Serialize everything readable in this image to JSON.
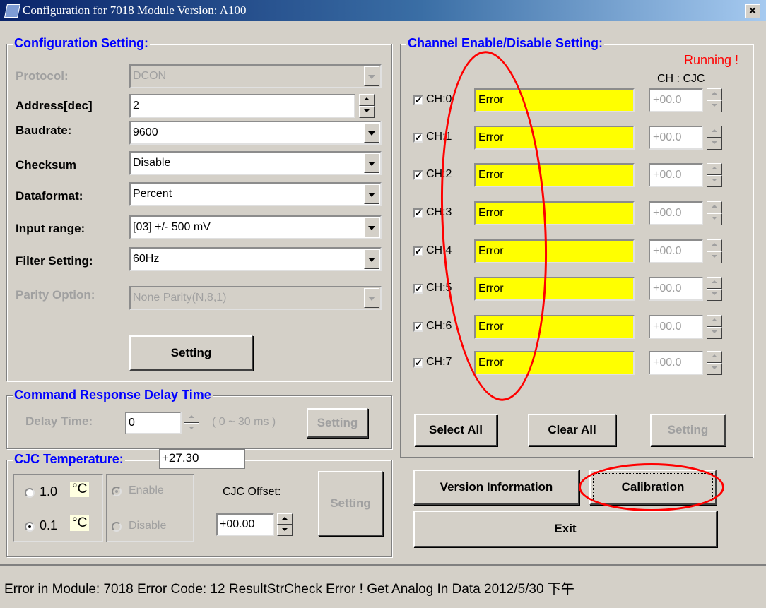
{
  "window": {
    "title": "Configuration for 7018 Module Version: A100",
    "close_glyph": "✕"
  },
  "config": {
    "legend": "Configuration Setting:",
    "protocol_label": "Protocol:",
    "protocol_value": "DCON",
    "address_label": "Address[dec]",
    "address_value": "2",
    "baud_label": "Baudrate:",
    "baud_value": "9600",
    "checksum_label": "Checksum",
    "checksum_value": "Disable",
    "dataformat_label": "Dataformat:",
    "dataformat_value": "Percent",
    "range_label": "Input range:",
    "range_value": "[03] +/- 500 mV",
    "filter_label": "Filter Setting:",
    "filter_value": "60Hz",
    "parity_label": "Parity Option:",
    "parity_value": "None Parity(N,8,1)",
    "setting_button": "Setting"
  },
  "delay": {
    "legend": "Command Response Delay Time",
    "label": "Delay Time:",
    "value": "0",
    "range": "( 0 ~ 30 ms )",
    "setting_button": "Setting"
  },
  "cjc": {
    "legend": "CJC Temperature:",
    "temperature": "+27.30",
    "res_1": "1.0",
    "res_01": "0.1",
    "unit": "°C",
    "enable": "Enable",
    "disable": "Disable",
    "offset_label": "CJC Offset:",
    "offset_value": "+00.00",
    "setting_button": "Setting"
  },
  "channels": {
    "legend": "Channel Enable/Disable Setting:",
    "running": "Running !",
    "ch_cjc_header": "CH : CJC",
    "check_glyph": "✓",
    "items": [
      {
        "label": "CH:0",
        "value": "Error",
        "cjc": "+00.0",
        "checked": true
      },
      {
        "label": "CH:1",
        "value": "Error",
        "cjc": "+00.0",
        "checked": true
      },
      {
        "label": "CH:2",
        "value": "Error",
        "cjc": "+00.0",
        "checked": true
      },
      {
        "label": "CH:3",
        "value": "Error",
        "cjc": "+00.0",
        "checked": true
      },
      {
        "label": "CH:4",
        "value": "Error",
        "cjc": "+00.0",
        "checked": true
      },
      {
        "label": "CH:5",
        "value": "Error",
        "cjc": "+00.0",
        "checked": true
      },
      {
        "label": "CH:6",
        "value": "Error",
        "cjc": "+00.0",
        "checked": true
      },
      {
        "label": "CH:7",
        "value": "Error",
        "cjc": "+00.0",
        "checked": true
      }
    ],
    "select_all": "Select All",
    "clear_all": "Clear All",
    "setting_button": "Setting"
  },
  "actions": {
    "version_info": "Version Information",
    "calibration": "Calibration",
    "exit": "Exit"
  },
  "status": {
    "text": "Error in Module: 7018  Error Code:  12    ResultStrCheck Error !   Get Analog In Data 2012/5/30 下午"
  },
  "colors": {
    "title_start": "#0a246a",
    "legend": "#0000ff",
    "error_field": "#ffff00",
    "annotation": "#ff0000",
    "running": "#ff0000"
  }
}
